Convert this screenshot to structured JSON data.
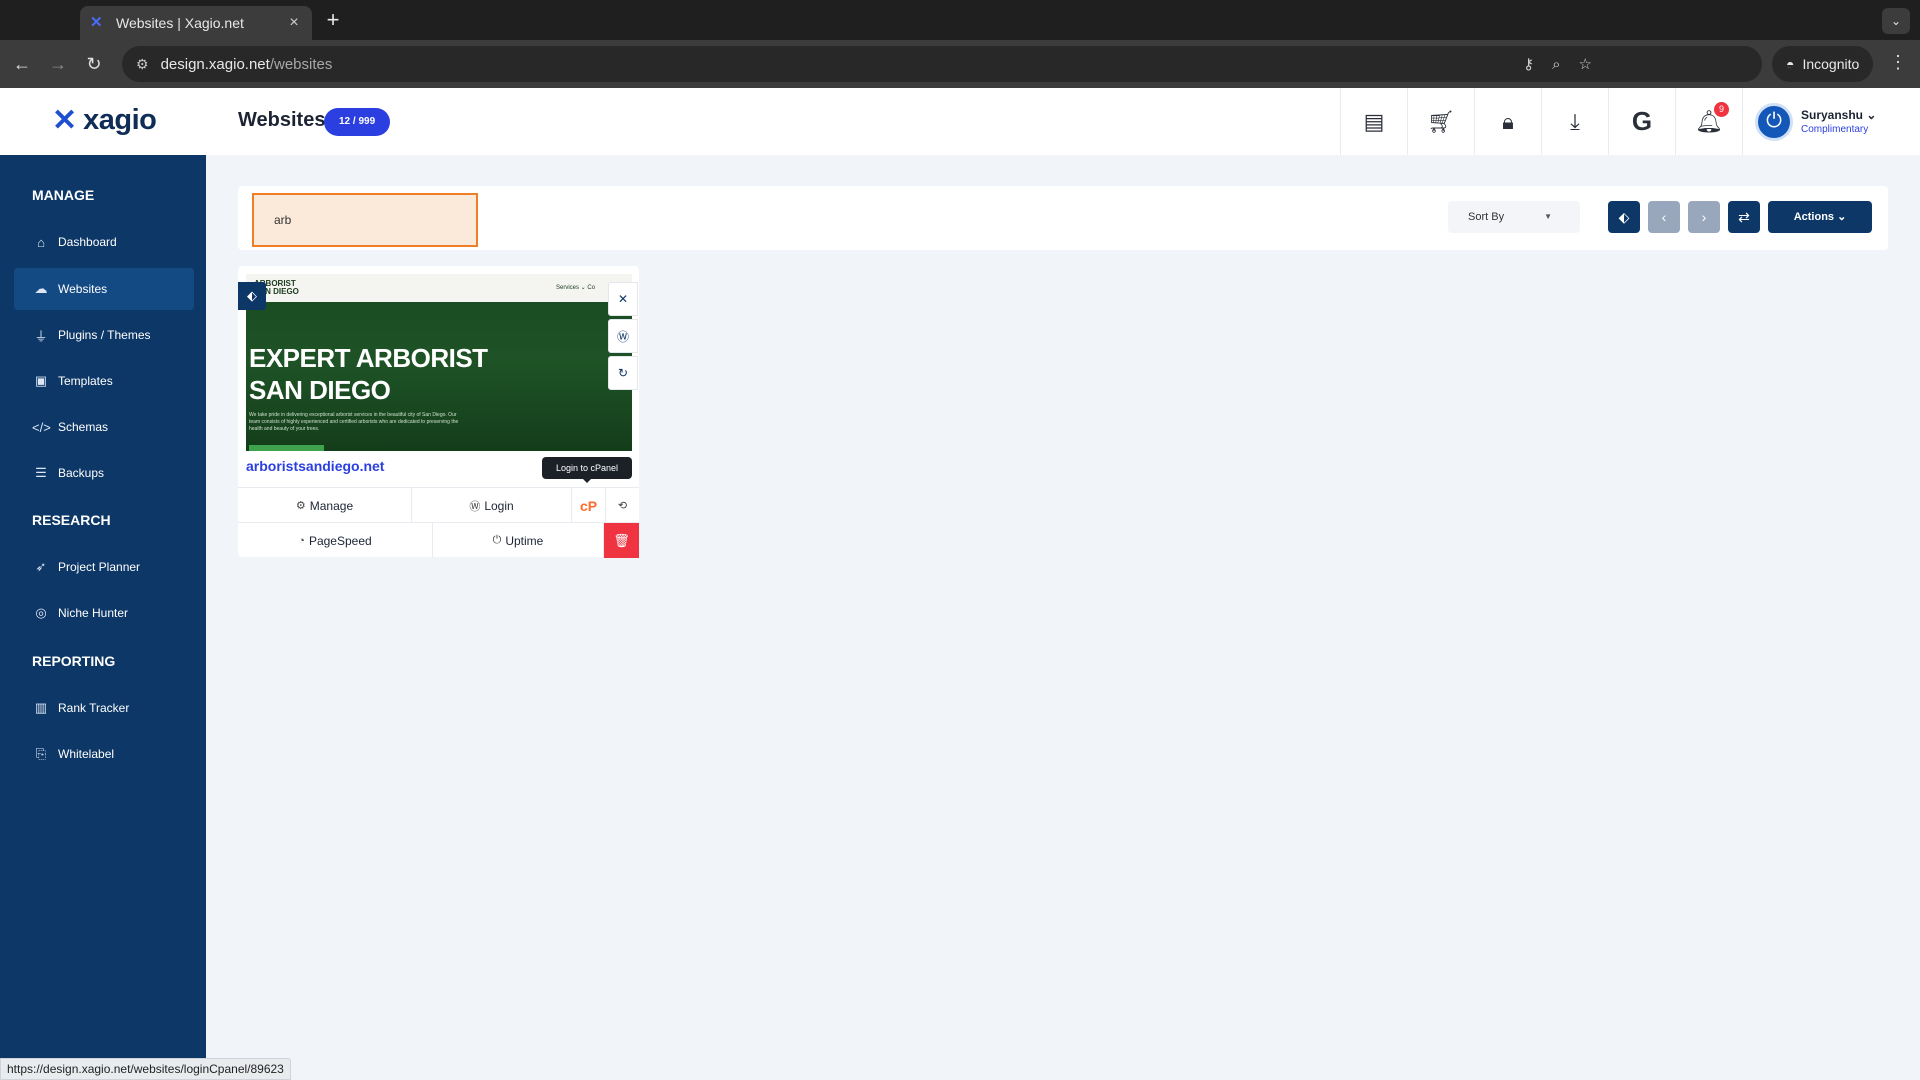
{
  "browser": {
    "tab_title": "Websites | Xagio.net",
    "url_host": "design.xagio.net",
    "url_path": "/websites",
    "profile_label": "Incognito"
  },
  "header": {
    "logo_text": "xagio",
    "page_title": "Websites",
    "count_badge": "12 / 999",
    "notification_count": "9",
    "user_name": "Suryanshu",
    "user_plan": "Complimentary"
  },
  "sidebar": {
    "sections": [
      {
        "label": "MANAGE",
        "items": [
          {
            "label": "Dashboard",
            "icon": "home-icon"
          },
          {
            "label": "Websites",
            "icon": "cloud-icon"
          },
          {
            "label": "Plugins / Themes",
            "icon": "plug-icon"
          },
          {
            "label": "Templates",
            "icon": "image-icon"
          },
          {
            "label": "Schemas",
            "icon": "code-icon"
          },
          {
            "label": "Backups",
            "icon": "database-icon"
          }
        ]
      },
      {
        "label": "RESEARCH",
        "items": [
          {
            "label": "Project Planner",
            "icon": "rocket-icon"
          },
          {
            "label": "Niche Hunter",
            "icon": "target-icon"
          }
        ]
      },
      {
        "label": "REPORTING",
        "items": [
          {
            "label": "Rank Tracker",
            "icon": "bar-chart-icon"
          },
          {
            "label": "Whitelabel",
            "icon": "bookmark-icon"
          }
        ]
      }
    ]
  },
  "filters": {
    "search_value": "arb",
    "sort_label": "Sort By",
    "actions_label": "Actions"
  },
  "card": {
    "site_brand_line1": "ARBORIST",
    "site_brand_line2": "SAN DIEGO",
    "site_nav": "Services ⌄    Co",
    "headline_line1": "EXPERT ARBORIST",
    "headline_line2": "SAN DIEGO",
    "body_text": "We take pride in delivering exceptional arborist services in the beautiful city of San Diego. Our team consists of highly experienced and certified arborists who are dedicated to preserving the health and beauty of your trees.",
    "domain": "arboristsandiego.net",
    "tooltip": "Login to cPanel",
    "manage_label": "Manage",
    "login_label": "Login",
    "pagespeed_label": "PageSpeed",
    "uptime_label": "Uptime"
  },
  "status_bar_url": "https://design.xagio.net/websites/loginCpanel/89623",
  "colors": {
    "sidebar": "#0d3766",
    "accent": "#2b3fe0",
    "search_border": "#f07d27",
    "delete": "#ef3340"
  }
}
